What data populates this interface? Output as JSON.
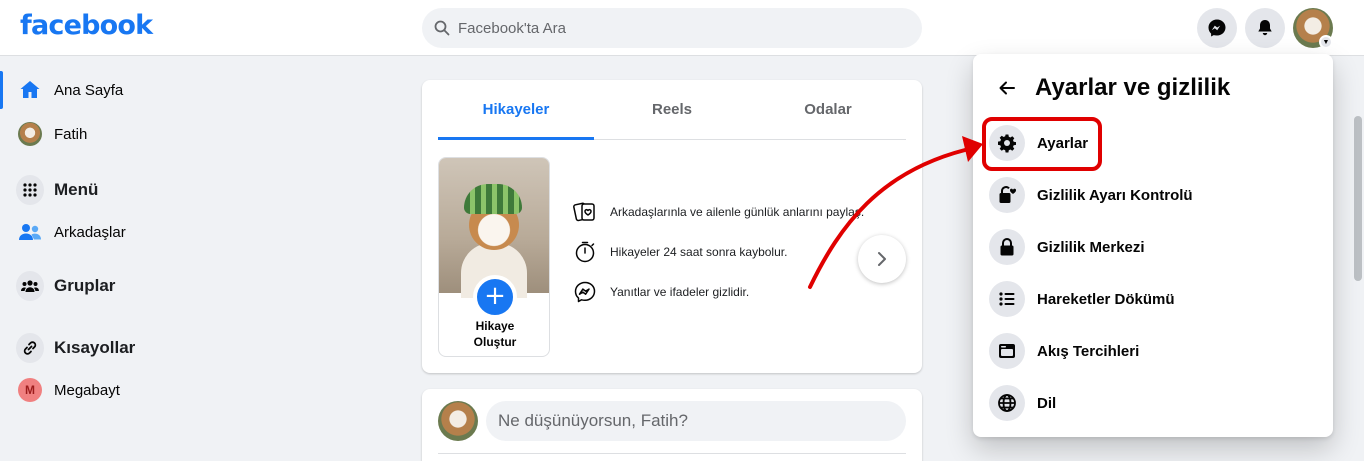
{
  "header": {
    "logo": "facebook",
    "search_placeholder": "Facebook'ta Ara",
    "icons": [
      "messenger-icon",
      "bell-icon",
      "profile-avatar"
    ]
  },
  "sidebar": {
    "items": [
      {
        "label": "Ana Sayfa",
        "icon": "home-icon",
        "active": true
      },
      {
        "label": "Fatih",
        "icon": "user-avatar"
      },
      {
        "label": "Menü",
        "icon": "grid-icon"
      },
      {
        "label": "Arkadaşlar",
        "icon": "friends-icon"
      },
      {
        "label": "Gruplar",
        "icon": "groups-icon"
      },
      {
        "label": "Kısayollar",
        "icon": "link-icon"
      },
      {
        "label": "Megabayt",
        "icon": "m-avatar",
        "avatar_letter": "M"
      }
    ]
  },
  "stories": {
    "tabs": [
      {
        "label": "Hikayeler",
        "active": true
      },
      {
        "label": "Reels"
      },
      {
        "label": "Odalar"
      }
    ],
    "create_label_line1": "Hikaye",
    "create_label_line2": "Oluştur",
    "info": [
      {
        "text": "Arkadaşlarınla ve ailenle günlük anlarını paylaş.",
        "icon": "cards-icon"
      },
      {
        "text": "Hikayeler 24 saat sonra kaybolur.",
        "icon": "timer-icon"
      },
      {
        "text": "Yanıtlar ve ifadeler gizlidir.",
        "icon": "messenger-icon"
      }
    ]
  },
  "composer": {
    "placeholder": "Ne düşünüyorsun, Fatih?"
  },
  "dropdown": {
    "title": "Ayarlar ve gizlilik",
    "items": [
      {
        "label": "Ayarlar",
        "icon": "gear-icon",
        "highlighted": true
      },
      {
        "label": "Gizlilik Ayarı Kontrolü",
        "icon": "lock-heart-icon"
      },
      {
        "label": "Gizlilik Merkezi",
        "icon": "lock-icon"
      },
      {
        "label": "Hareketler Dökümü",
        "icon": "list-icon"
      },
      {
        "label": "Akış Tercihleri",
        "icon": "feed-icon"
      },
      {
        "label": "Dil",
        "icon": "globe-icon"
      }
    ]
  },
  "colors": {
    "brand": "#1877f2",
    "annotation": "#e00000"
  }
}
